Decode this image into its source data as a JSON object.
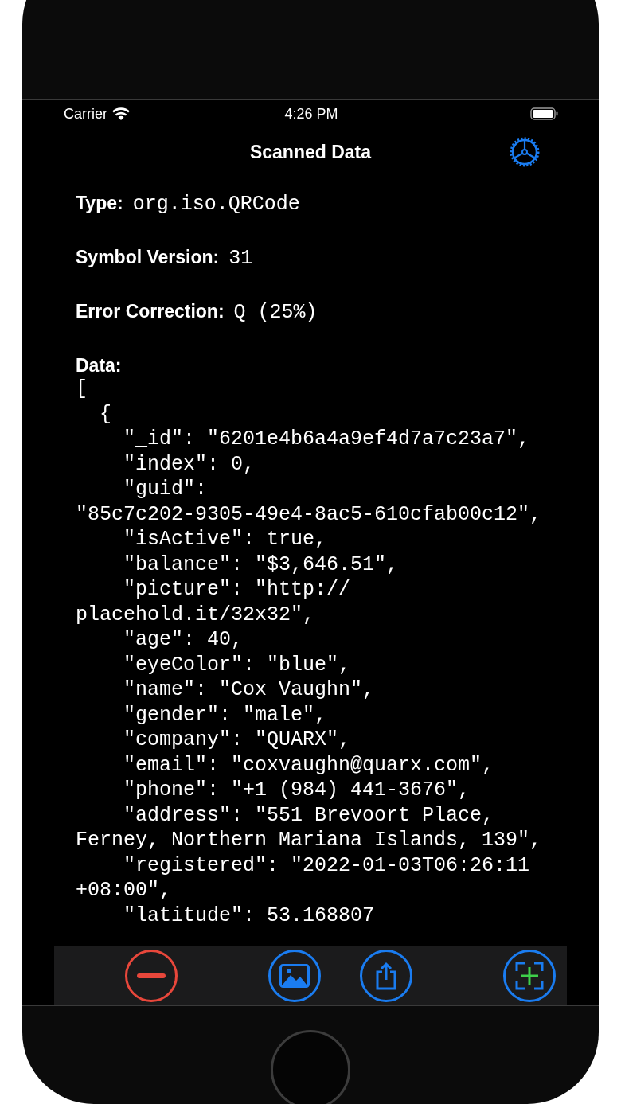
{
  "status_bar": {
    "carrier": "Carrier",
    "time": "4:26 PM"
  },
  "nav": {
    "title": "Scanned Data"
  },
  "fields": [
    {
      "label": "Type:",
      "value": "org.iso.QRCode"
    },
    {
      "label": "Symbol Version:",
      "value": "31"
    },
    {
      "label": "Error Correction:",
      "value": "Q (25%)"
    }
  ],
  "data": {
    "label": "Data:",
    "lines": [
      "[",
      "  {",
      "    \"_id\": \"6201e4b6a4a9ef4d7a7c23a7\",",
      "    \"index\": 0,",
      "    \"guid\":",
      "\"85c7c202-9305-49e4-8ac5-610cfab00c12\",",
      "    \"isActive\": true,",
      "    \"balance\": \"$3,646.51\",",
      "    \"picture\": \"http://",
      "placehold.it/32x32\",",
      "    \"age\": 40,",
      "    \"eyeColor\": \"blue\",",
      "    \"name\": \"Cox Vaughn\",",
      "    \"gender\": \"male\",",
      "    \"company\": \"QUARX\",",
      "    \"email\": \"coxvaughn@quarx.com\",",
      "    \"phone\": \"+1 (984) 441-3676\",",
      "    \"address\": \"551 Brevoort Place,",
      "Ferney, Northern Mariana Islands, 139\",",
      "    \"registered\": \"2022-01-03T06:26:11",
      "+08:00\",",
      "    \"latitude\": 53.168807"
    ]
  },
  "toolbar": [
    {
      "kind": "remove"
    },
    {
      "kind": "photo"
    },
    {
      "kind": "share"
    },
    {
      "kind": "scan"
    }
  ]
}
